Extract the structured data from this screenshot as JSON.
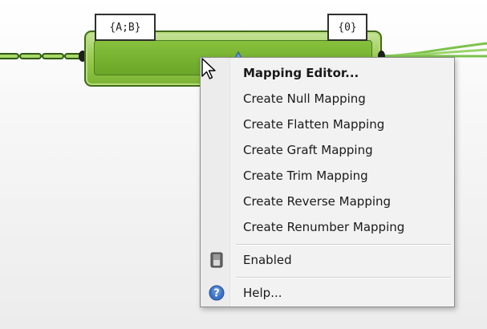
{
  "component": {
    "input_param": "{A;B}",
    "output_param": "{0}"
  },
  "menu": {
    "items": [
      {
        "label": "Mapping Editor...",
        "bold": true
      },
      {
        "label": "Create Null Mapping"
      },
      {
        "label": "Create Flatten Mapping"
      },
      {
        "label": "Create Graft Mapping"
      },
      {
        "label": "Create Trim Mapping"
      },
      {
        "label": "Create Reverse Mapping"
      },
      {
        "label": "Create Renumber Mapping"
      }
    ],
    "enabled": {
      "label": "Enabled",
      "icon": "toggle-icon"
    },
    "help": {
      "label": "Help...",
      "icon": "help-icon"
    }
  },
  "colors": {
    "component_green": "#7bb332",
    "menu_background": "#f2f2f2",
    "help_blue": "#3b73c8"
  }
}
